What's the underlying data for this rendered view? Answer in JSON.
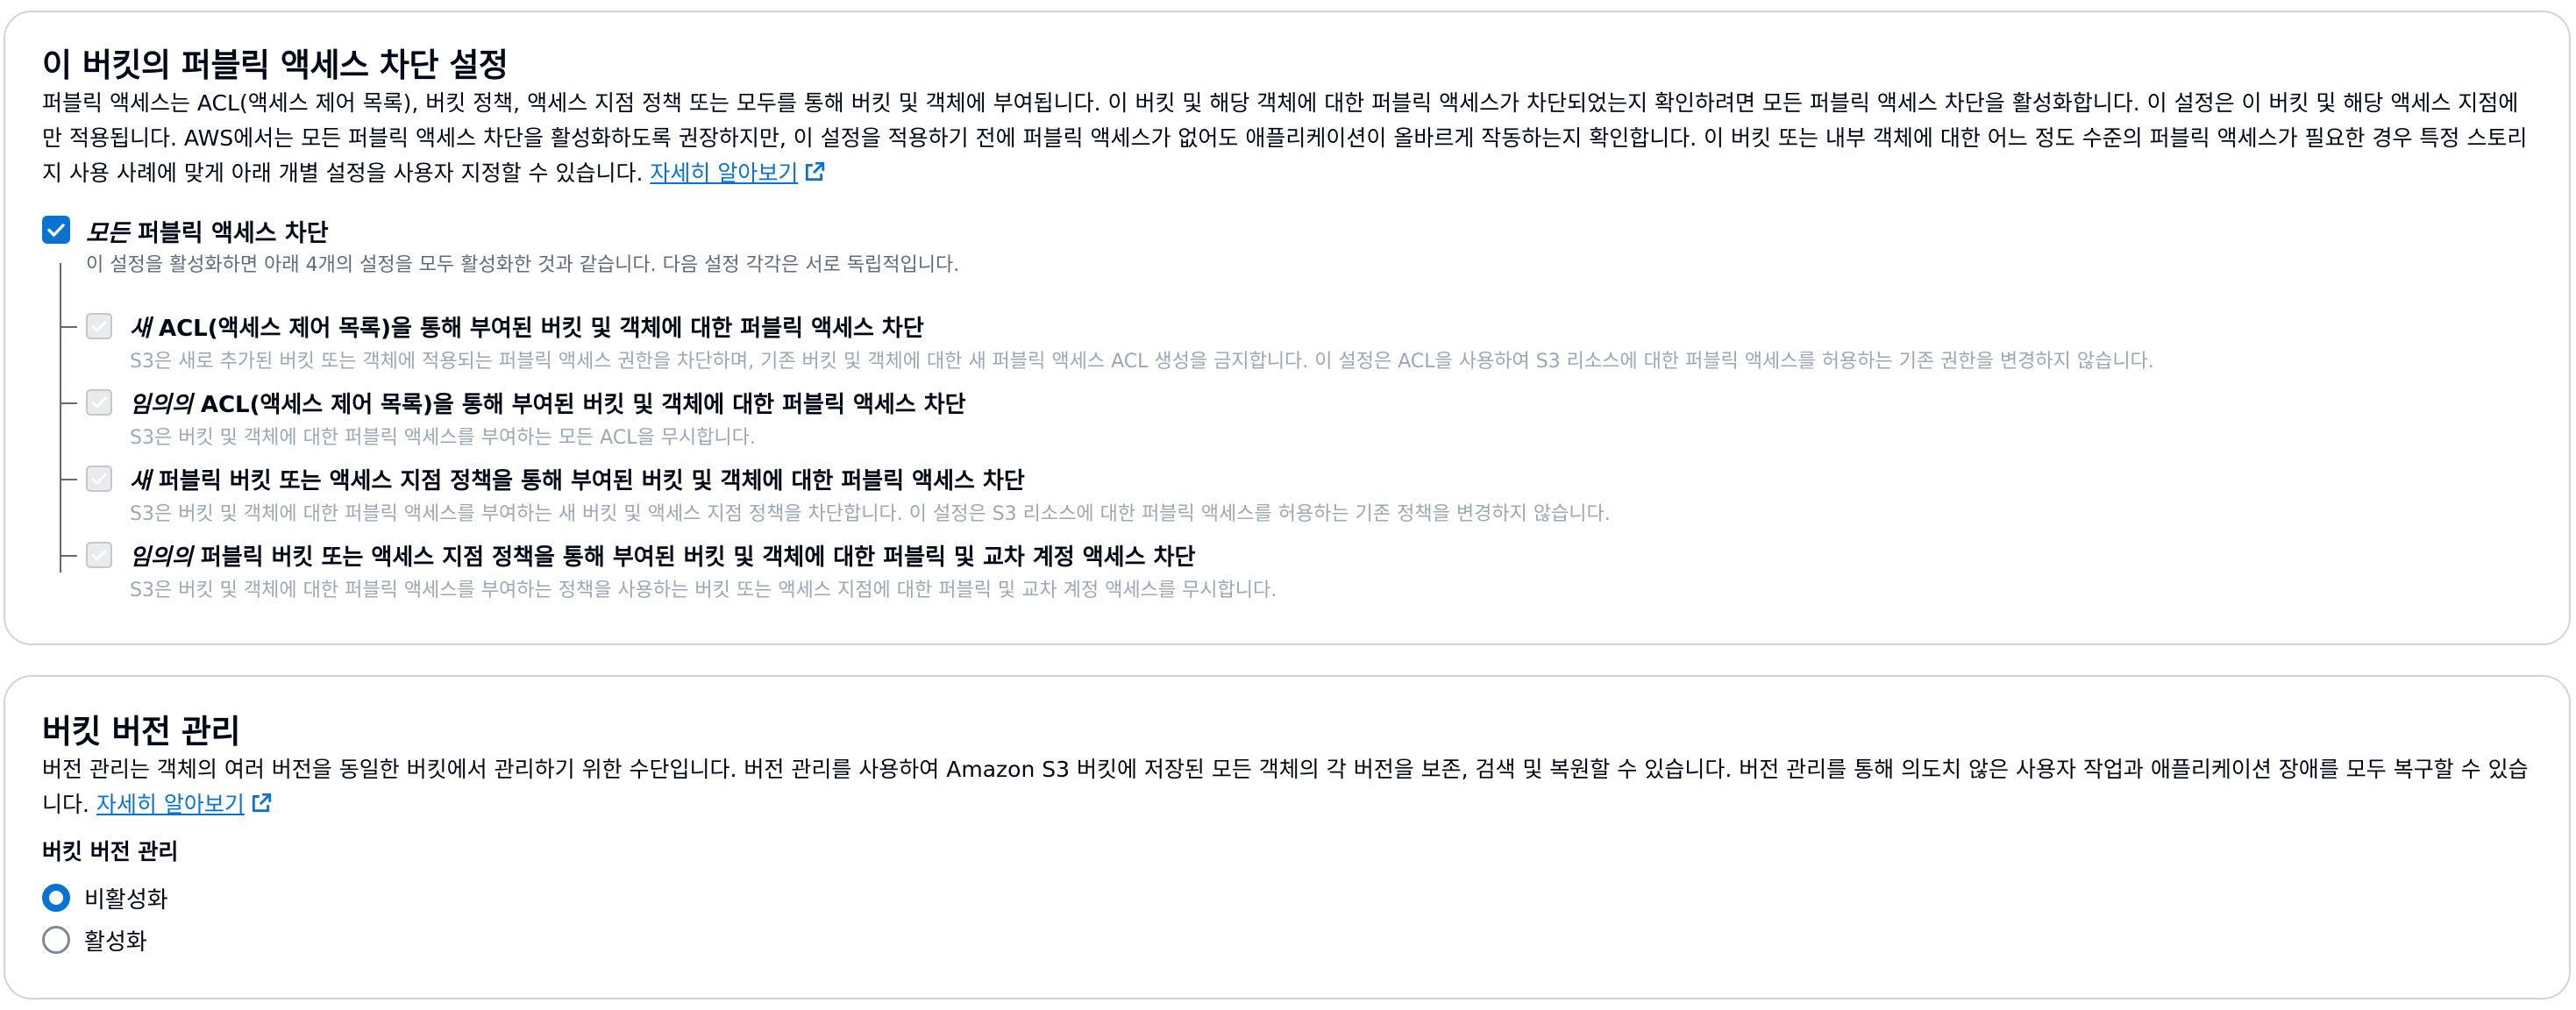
{
  "public_access": {
    "title": "이 버킷의 퍼블릭 액세스 차단 설정",
    "description": "퍼블릭 액세스는 ACL(액세스 제어 목록), 버킷 정책, 액세스 지점 정책 또는 모두를 통해 버킷 및 객체에 부여됩니다. 이 버킷 및 해당 객체에 대한 퍼블릭 액세스가 차단되었는지 확인하려면 모든 퍼블릭 액세스 차단을 활성화합니다. 이 설정은 이 버킷 및 해당 액세스 지점에만 적용됩니다. AWS에서는 모든 퍼블릭 액세스 차단을 활성화하도록 권장하지만, 이 설정을 적용하기 전에 퍼블릭 액세스가 없어도 애플리케이션이 올바르게 작동하는지 확인합니다. 이 버킷 또는 내부 객체에 대한 어느 정도 수준의 퍼블릭 액세스가 필요한 경우 특정 스토리지 사용 사례에 맞게 아래 개별 설정을 사용자 지정할 수 있습니다.",
    "learn_more": "자세히 알아보기",
    "block_all": {
      "label_em": "모든",
      "label_rest": " 퍼블릭 액세스 차단",
      "checked": true,
      "description": "이 설정을 활성화하면 아래 4개의 설정을 모두 활성화한 것과 같습니다. 다음 설정 각각은 서로 독립적입니다."
    },
    "options": [
      {
        "label_em": "새",
        "label_rest": " ACL(액세스 제어 목록)을 통해 부여된 버킷 및 객체에 대한 퍼블릭 액세스 차단",
        "description": "S3은 새로 추가된 버킷 또는 객체에 적용되는 퍼블릭 액세스 권한을 차단하며, 기존 버킷 및 객체에 대한 새 퍼블릭 액세스 ACL 생성을 금지합니다. 이 설정은 ACL을 사용하여 S3 리소스에 대한 퍼블릭 액세스를 허용하는 기존 권한을 변경하지 않습니다."
      },
      {
        "label_em": "임의의",
        "label_rest": " ACL(액세스 제어 목록)을 통해 부여된 버킷 및 객체에 대한 퍼블릭 액세스 차단",
        "description": "S3은 버킷 및 객체에 대한 퍼블릭 액세스를 부여하는 모든 ACL을 무시합니다."
      },
      {
        "label_em": "새",
        "label_rest": " 퍼블릭 버킷 또는 액세스 지점 정책을 통해 부여된 버킷 및 객체에 대한 퍼블릭 액세스 차단",
        "description": "S3은 버킷 및 객체에 대한 퍼블릭 액세스를 부여하는 새 버킷 및 액세스 지점 정책을 차단합니다. 이 설정은 S3 리소스에 대한 퍼블릭 액세스를 허용하는 기존 정책을 변경하지 않습니다."
      },
      {
        "label_em": "임의의",
        "label_rest": " 퍼블릭 버킷 또는 액세스 지점 정책을 통해 부여된 버킷 및 객체에 대한 퍼블릭 및 교차 계정 액세스 차단",
        "description": "S3은 버킷 및 객체에 대한 퍼블릭 액세스를 부여하는 정책을 사용하는 버킷 또는 액세스 지점에 대한 퍼블릭 및 교차 계정 액세스를 무시합니다."
      }
    ]
  },
  "versioning": {
    "title": "버킷 버전 관리",
    "description": "버전 관리는 객체의 여러 버전을 동일한 버킷에서 관리하기 위한 수단입니다. 버전 관리를 사용하여 Amazon S3 버킷에 저장된 모든 객체의 각 버전을 보존, 검색 및 복원할 수 있습니다. 버전 관리를 통해 의도치 않은 사용자 작업과 애플리케이션 장애를 모두 복구할 수 있습니다.",
    "learn_more": "자세히 알아보기",
    "field_label": "버킷 버전 관리",
    "options": [
      "비활성화",
      "활성화"
    ],
    "selected": "비활성화"
  },
  "colors": {
    "accent": "#0972d3",
    "text": "#000716",
    "secondary_text": "#5f6b7a",
    "disabled_text": "#9ba7b6",
    "border": "#d1d5db"
  }
}
